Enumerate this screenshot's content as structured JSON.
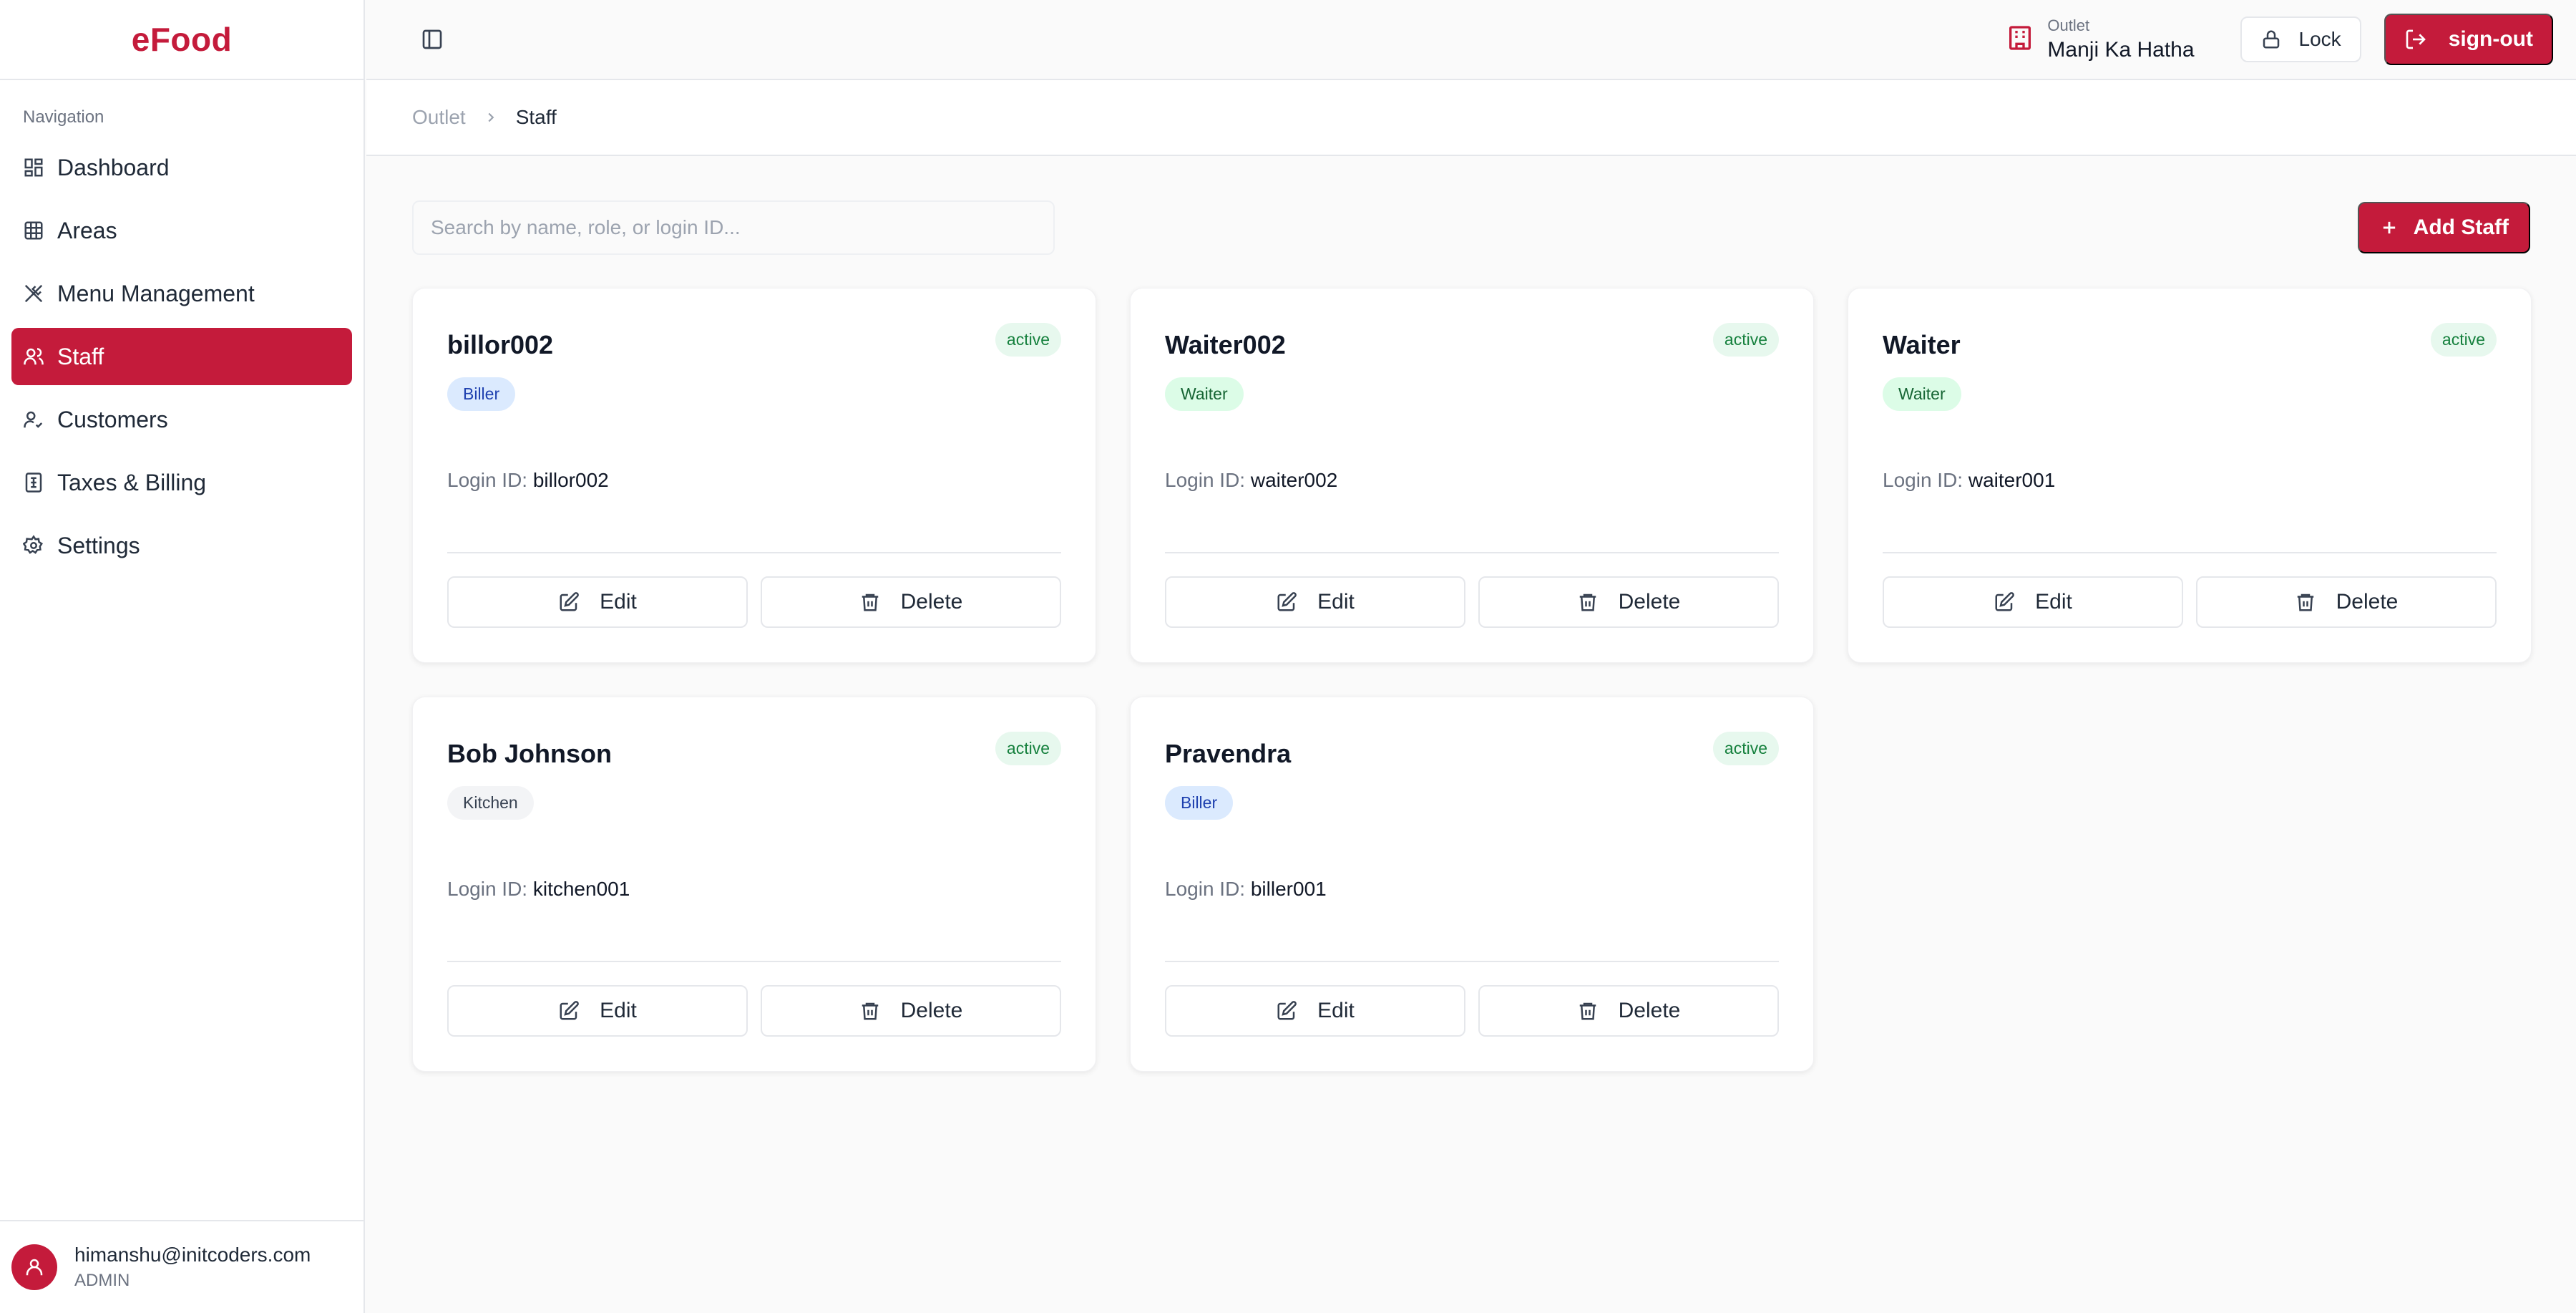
{
  "brand": {
    "name": "eFood",
    "accent": "#c41b3b"
  },
  "sidebar": {
    "heading": "Navigation",
    "items": [
      {
        "label": "Dashboard",
        "icon": "dashboard-icon",
        "active": false
      },
      {
        "label": "Areas",
        "icon": "grid-icon",
        "active": false
      },
      {
        "label": "Menu Management",
        "icon": "utensils-icon",
        "active": false
      },
      {
        "label": "Staff",
        "icon": "users-icon",
        "active": true
      },
      {
        "label": "Customers",
        "icon": "user-check-icon",
        "active": false
      },
      {
        "label": "Taxes & Billing",
        "icon": "receipt-icon",
        "active": false
      },
      {
        "label": "Settings",
        "icon": "gear-icon",
        "active": false
      }
    ],
    "user": {
      "email": "himanshu@initcoders.com",
      "role": "ADMIN"
    }
  },
  "topbar": {
    "outlet_label": "Outlet",
    "outlet_name": "Manji Ka Hatha",
    "lock_label": "Lock",
    "signout_label": "sign-out"
  },
  "breadcrumb": {
    "parent": "Outlet",
    "current": "Staff"
  },
  "toolbar": {
    "search_placeholder": "Search by name, role, or login ID...",
    "add_label": "Add Staff"
  },
  "staff": [
    {
      "name": "billor002",
      "status": "active",
      "role": "Biller",
      "login_label": "Login ID:",
      "login_id": "billor002",
      "edit_label": "Edit",
      "delete_label": "Delete"
    },
    {
      "name": "Waiter002",
      "status": "active",
      "role": "Waiter",
      "login_label": "Login ID:",
      "login_id": "waiter002",
      "edit_label": "Edit",
      "delete_label": "Delete"
    },
    {
      "name": "Waiter",
      "status": "active",
      "role": "Waiter",
      "login_label": "Login ID:",
      "login_id": "waiter001",
      "edit_label": "Edit",
      "delete_label": "Delete"
    },
    {
      "name": "Bob Johnson",
      "status": "active",
      "role": "Kitchen",
      "login_label": "Login ID:",
      "login_id": "kitchen001",
      "edit_label": "Edit",
      "delete_label": "Delete"
    },
    {
      "name": "Pravendra",
      "status": "active",
      "role": "Biller",
      "login_label": "Login ID:",
      "login_id": "biller001",
      "edit_label": "Edit",
      "delete_label": "Delete"
    }
  ]
}
